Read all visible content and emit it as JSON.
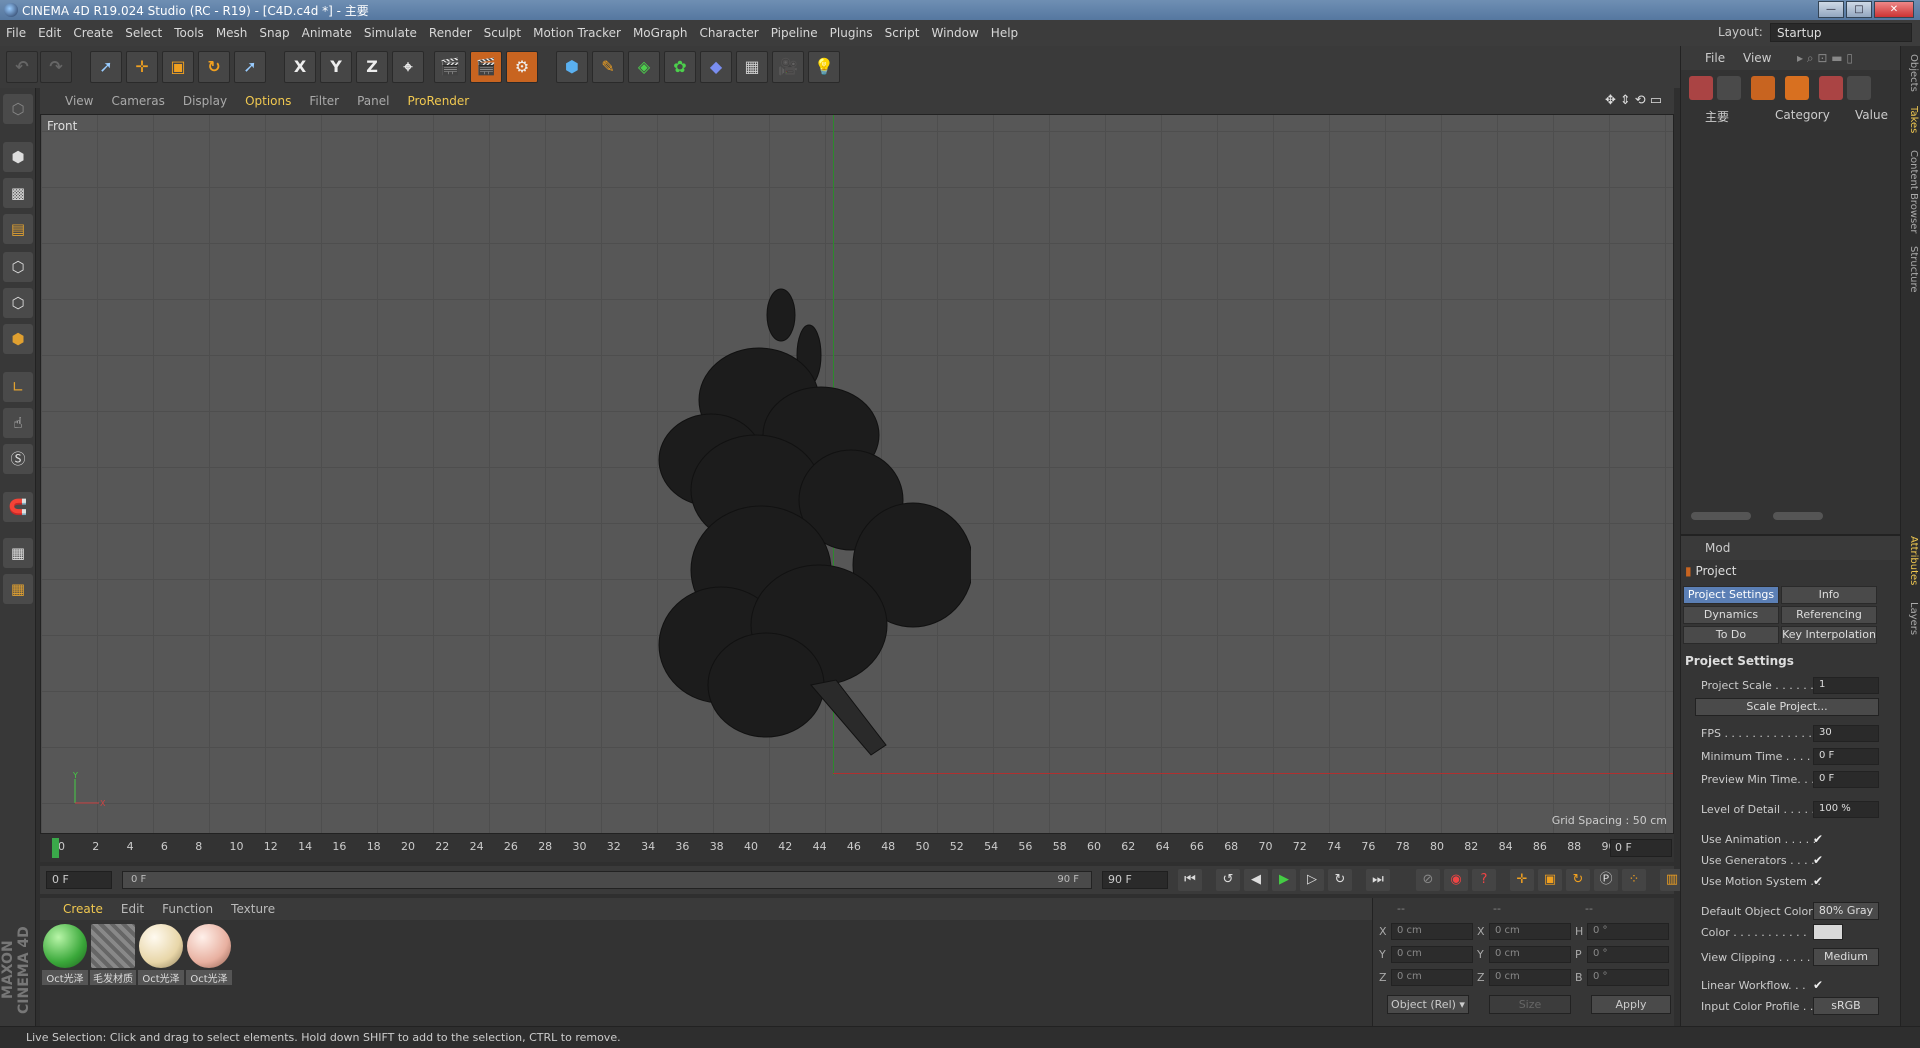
{
  "window": {
    "title": "CINEMA 4D R19.024 Studio (RC - R19) - [C4D.c4d *] - 主要",
    "buttons": [
      "—",
      "□",
      "✕"
    ]
  },
  "menu": [
    "File",
    "Edit",
    "Create",
    "Select",
    "Tools",
    "Mesh",
    "Snap",
    "Animate",
    "Simulate",
    "Render",
    "Sculpt",
    "Motion Tracker",
    "MoGraph",
    "Character",
    "Pipeline",
    "Plugins",
    "Script",
    "Window",
    "Help"
  ],
  "layout": {
    "label": "Layout:",
    "value": "Startup"
  },
  "toolbar": {
    "x": "X",
    "y": "Y",
    "z": "Z"
  },
  "viewport": {
    "menu": [
      "View",
      "Cameras",
      "Display",
      "Options",
      "Filter",
      "Panel",
      "ProRender"
    ],
    "highlighted_menu": [
      "Options",
      "ProRender"
    ],
    "label": "Front",
    "grid_spacing": "Grid Spacing : 50 cm"
  },
  "timeline": {
    "ticks": [
      "0",
      "2",
      "4",
      "6",
      "8",
      "10",
      "12",
      "14",
      "16",
      "18",
      "20",
      "22",
      "24",
      "26",
      "28",
      "30",
      "32",
      "34",
      "36",
      "38",
      "40",
      "42",
      "44",
      "46",
      "48",
      "50",
      "52",
      "54",
      "56",
      "58",
      "60",
      "62",
      "64",
      "66",
      "68",
      "70",
      "72",
      "74",
      "76",
      "78",
      "80",
      "82",
      "84",
      "86",
      "88",
      "90"
    ],
    "current_frame": "0 F",
    "start": "0 F",
    "slider_start": "0 F",
    "slider_end": "90 F",
    "end": "90 F"
  },
  "material_manager": {
    "menu": [
      "Create",
      "Edit",
      "Function",
      "Texture"
    ],
    "materials": [
      {
        "name": "Oct光泽",
        "color": "#4fc24f"
      },
      {
        "name": "毛发材质",
        "color": "#7a7a7a"
      },
      {
        "name": "Oct光泽",
        "color": "#f1e4c0"
      },
      {
        "name": "Oct光泽",
        "color": "#f0c2b0"
      }
    ]
  },
  "branding": "MAXON CINEMA 4D",
  "coordinates": {
    "headers": [
      "--",
      "--",
      "--"
    ],
    "rows": [
      {
        "a": "X",
        "av": "0 cm",
        "b": "X",
        "bv": "0 cm",
        "c": "H",
        "cv": "0 °"
      },
      {
        "a": "Y",
        "av": "0 cm",
        "b": "Y",
        "bv": "0 cm",
        "c": "P",
        "cv": "0 °"
      },
      {
        "a": "Z",
        "av": "0 cm",
        "b": "Z",
        "bv": "0 cm",
        "c": "B",
        "cv": "0 °"
      }
    ],
    "mode": "Object (Rel) ▾",
    "size": "Size",
    "apply": "Apply"
  },
  "status": "Live Selection: Click and drag to select elements. Hold down SHIFT to add to the selection, CTRL to remove.",
  "object_manager": {
    "menu": [
      "File",
      "View"
    ],
    "columns": [
      "主要",
      "Category",
      "Value"
    ]
  },
  "attributes": {
    "menu": "Mod",
    "object": "Project",
    "tabs": [
      "Project Settings",
      "Info",
      "Dynamics",
      "Referencing",
      "To Do",
      "Key Interpolation"
    ],
    "active_tab": "Project Settings",
    "section": "Project Settings",
    "rows": {
      "project_scale": {
        "label": "Project Scale . . . . . .",
        "value": "1"
      },
      "scale_project": "Scale Project...",
      "fps": {
        "label": "FPS . . . . . . . . . . . . . . .",
        "value": "30"
      },
      "min_time": {
        "label": "Minimum Time . . . . .",
        "value": "0 F"
      },
      "preview_min": {
        "label": "Preview Min Time. . .",
        "value": "0 F"
      },
      "lod": {
        "label": "Level of Detail . . . . .",
        "value": "100 %"
      },
      "use_animation": {
        "label": "Use Animation . . . . .",
        "value": "✔"
      },
      "use_generators": {
        "label": "Use Generators . . . .",
        "value": "✔"
      },
      "use_motion": {
        "label": "Use Motion System . .",
        "value": "✔"
      },
      "default_color": {
        "label": "Default Object Color",
        "value": "80% Gray"
      },
      "color": {
        "label": "Color . . . . . . . . . . .",
        "value": "#d8d8d8"
      },
      "view_clipping": {
        "label": "View Clipping . . . . .",
        "value": "Medium"
      },
      "linear_workflow": {
        "label": "Linear Workflow. . .",
        "value": "✔"
      },
      "input_color_profile": {
        "label": "Input Color Profile . .",
        "value": "sRGB"
      }
    }
  },
  "side_tabs": [
    "Objects",
    "Takes",
    "Content Browser",
    "Structure",
    "Attributes",
    "Layers"
  ]
}
